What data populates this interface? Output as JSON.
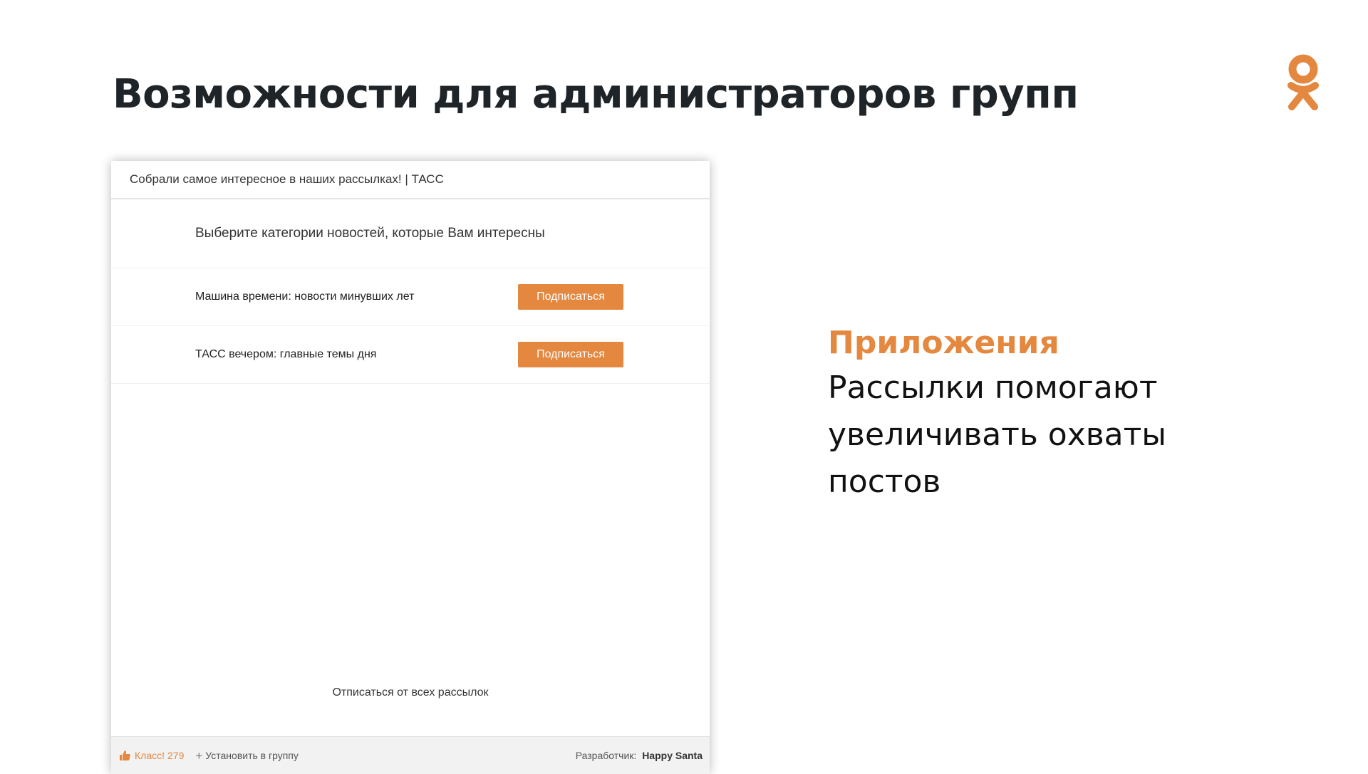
{
  "slide": {
    "title": "Возможности для администраторов групп",
    "accent_color": "#e4873f"
  },
  "logo": {
    "icon": "odnoklassniki-logo-icon",
    "color": "#e4873f"
  },
  "app": {
    "header_title": "Собрали самое интересное в наших рассылках! | ТАСС",
    "heading": "Выберите категории новостей, которые Вам интересны",
    "rows": [
      {
        "label": "Машина времени: новости минувших лет",
        "button": "Подписаться"
      },
      {
        "label": "ТАСС вечером: главные темы дня",
        "button": "Подписаться"
      }
    ],
    "unsubscribe": "Отписаться от всех рассылок",
    "footer": {
      "klass_icon": "thumbs-up-icon",
      "klass_label": "Класс!",
      "klass_count": "279",
      "install_icon": "plus-icon",
      "install_label": "Установить в группу",
      "developer_label": "Разработчик:",
      "developer_name": "Happy Santa"
    }
  },
  "side": {
    "accent": "Приложения",
    "body": "Рассылки помогают увеличивать охваты постов"
  }
}
